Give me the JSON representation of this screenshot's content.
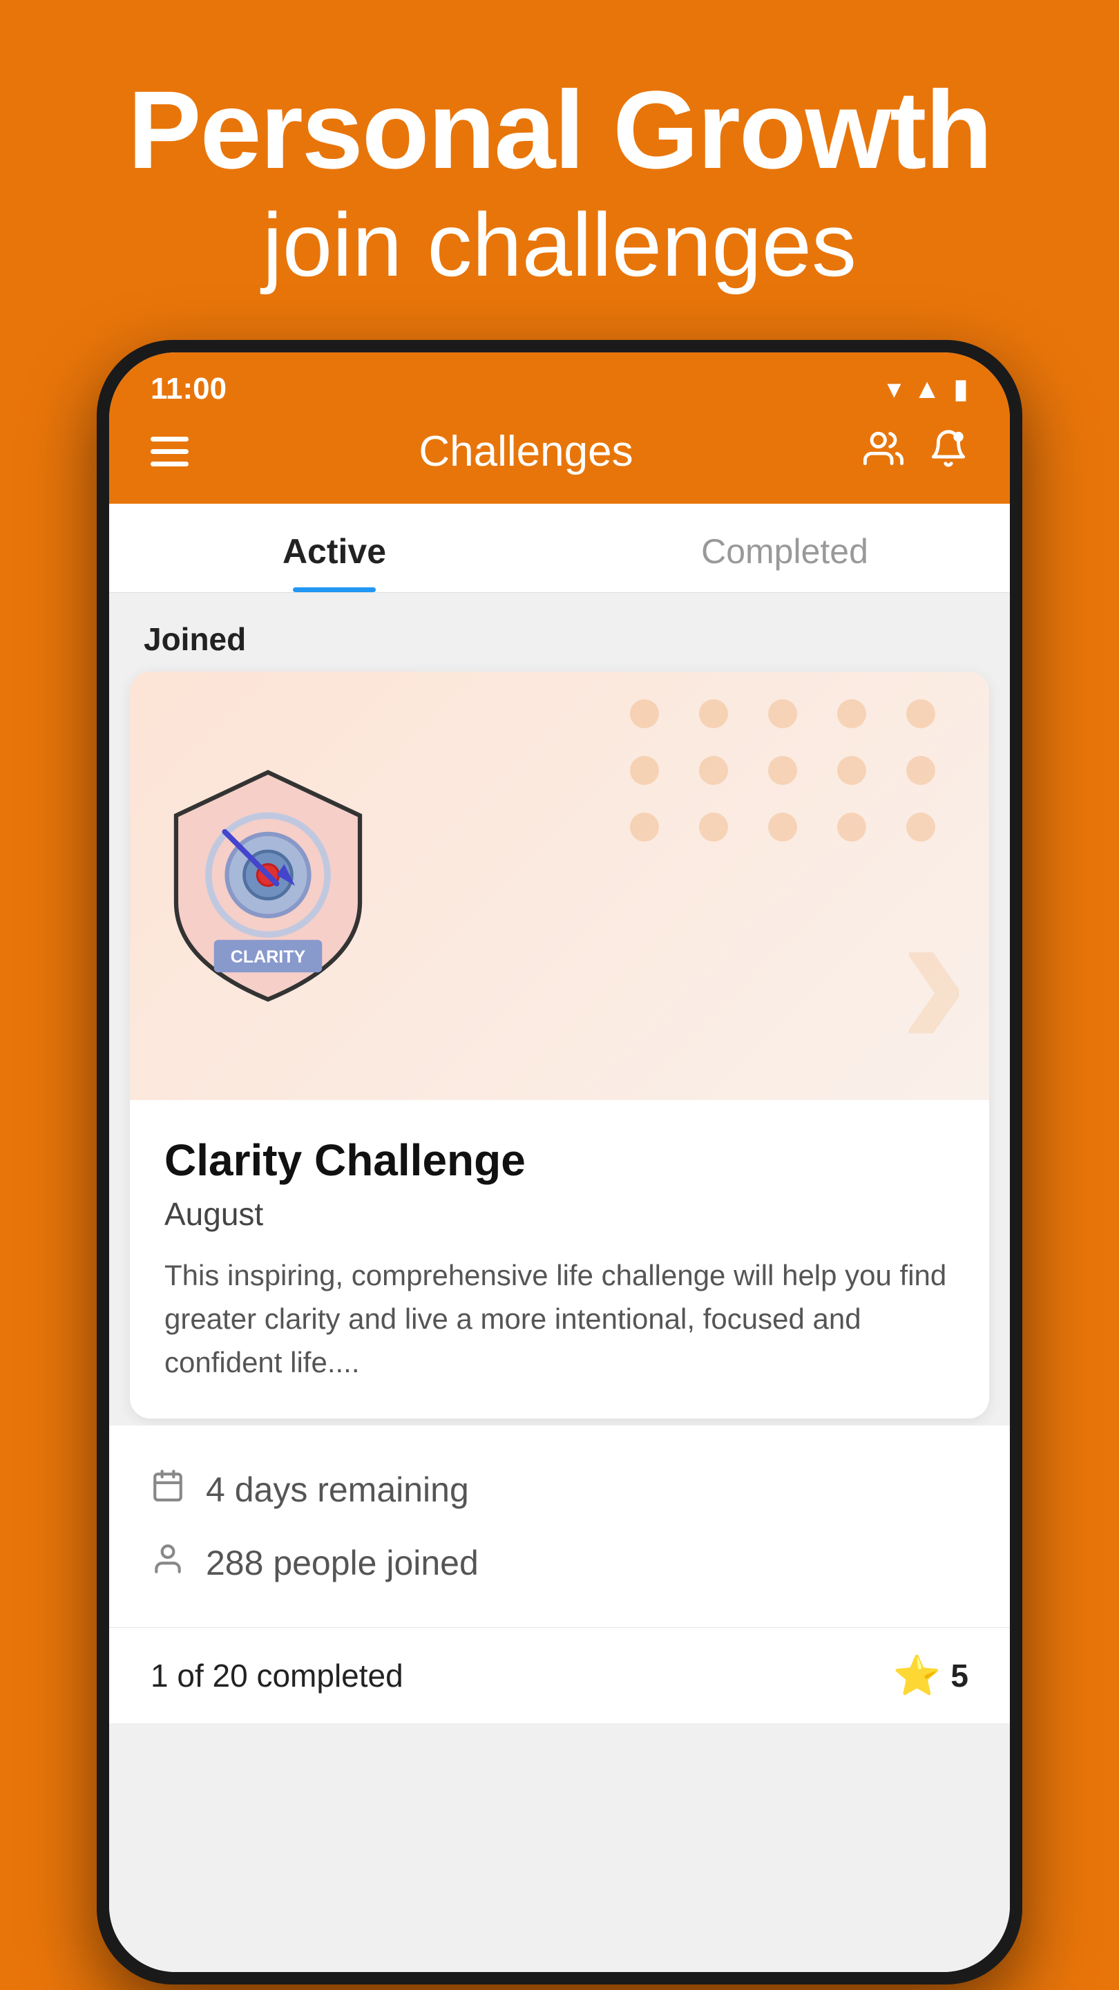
{
  "hero": {
    "title": "Personal Growth",
    "subtitle": "join challenges"
  },
  "status_bar": {
    "time": "11:00",
    "wifi": "▼",
    "signal": "▲",
    "battery": "▮"
  },
  "app_bar": {
    "title": "Challenges",
    "menu_icon": "☰",
    "people_icon": "👥",
    "bell_icon": "🔔"
  },
  "tabs": [
    {
      "label": "Active",
      "active": true
    },
    {
      "label": "Completed",
      "active": false
    }
  ],
  "section_label": "Joined",
  "challenge_card": {
    "title": "Clarity Challenge",
    "month": "August",
    "description": "This inspiring, comprehensive life challenge will help you find greater clarity and live a more intentional, focused and confident life....",
    "badge_text": "CLARITY"
  },
  "info_panel": {
    "days_remaining": "4 days remaining",
    "people_joined": "288 people joined"
  },
  "bottom_bar": {
    "completed_text": "1 of 20 completed",
    "stars": "5"
  },
  "colors": {
    "orange": "#E8750A",
    "blue": "#2196F3",
    "white": "#ffffff",
    "dark": "#111111"
  }
}
